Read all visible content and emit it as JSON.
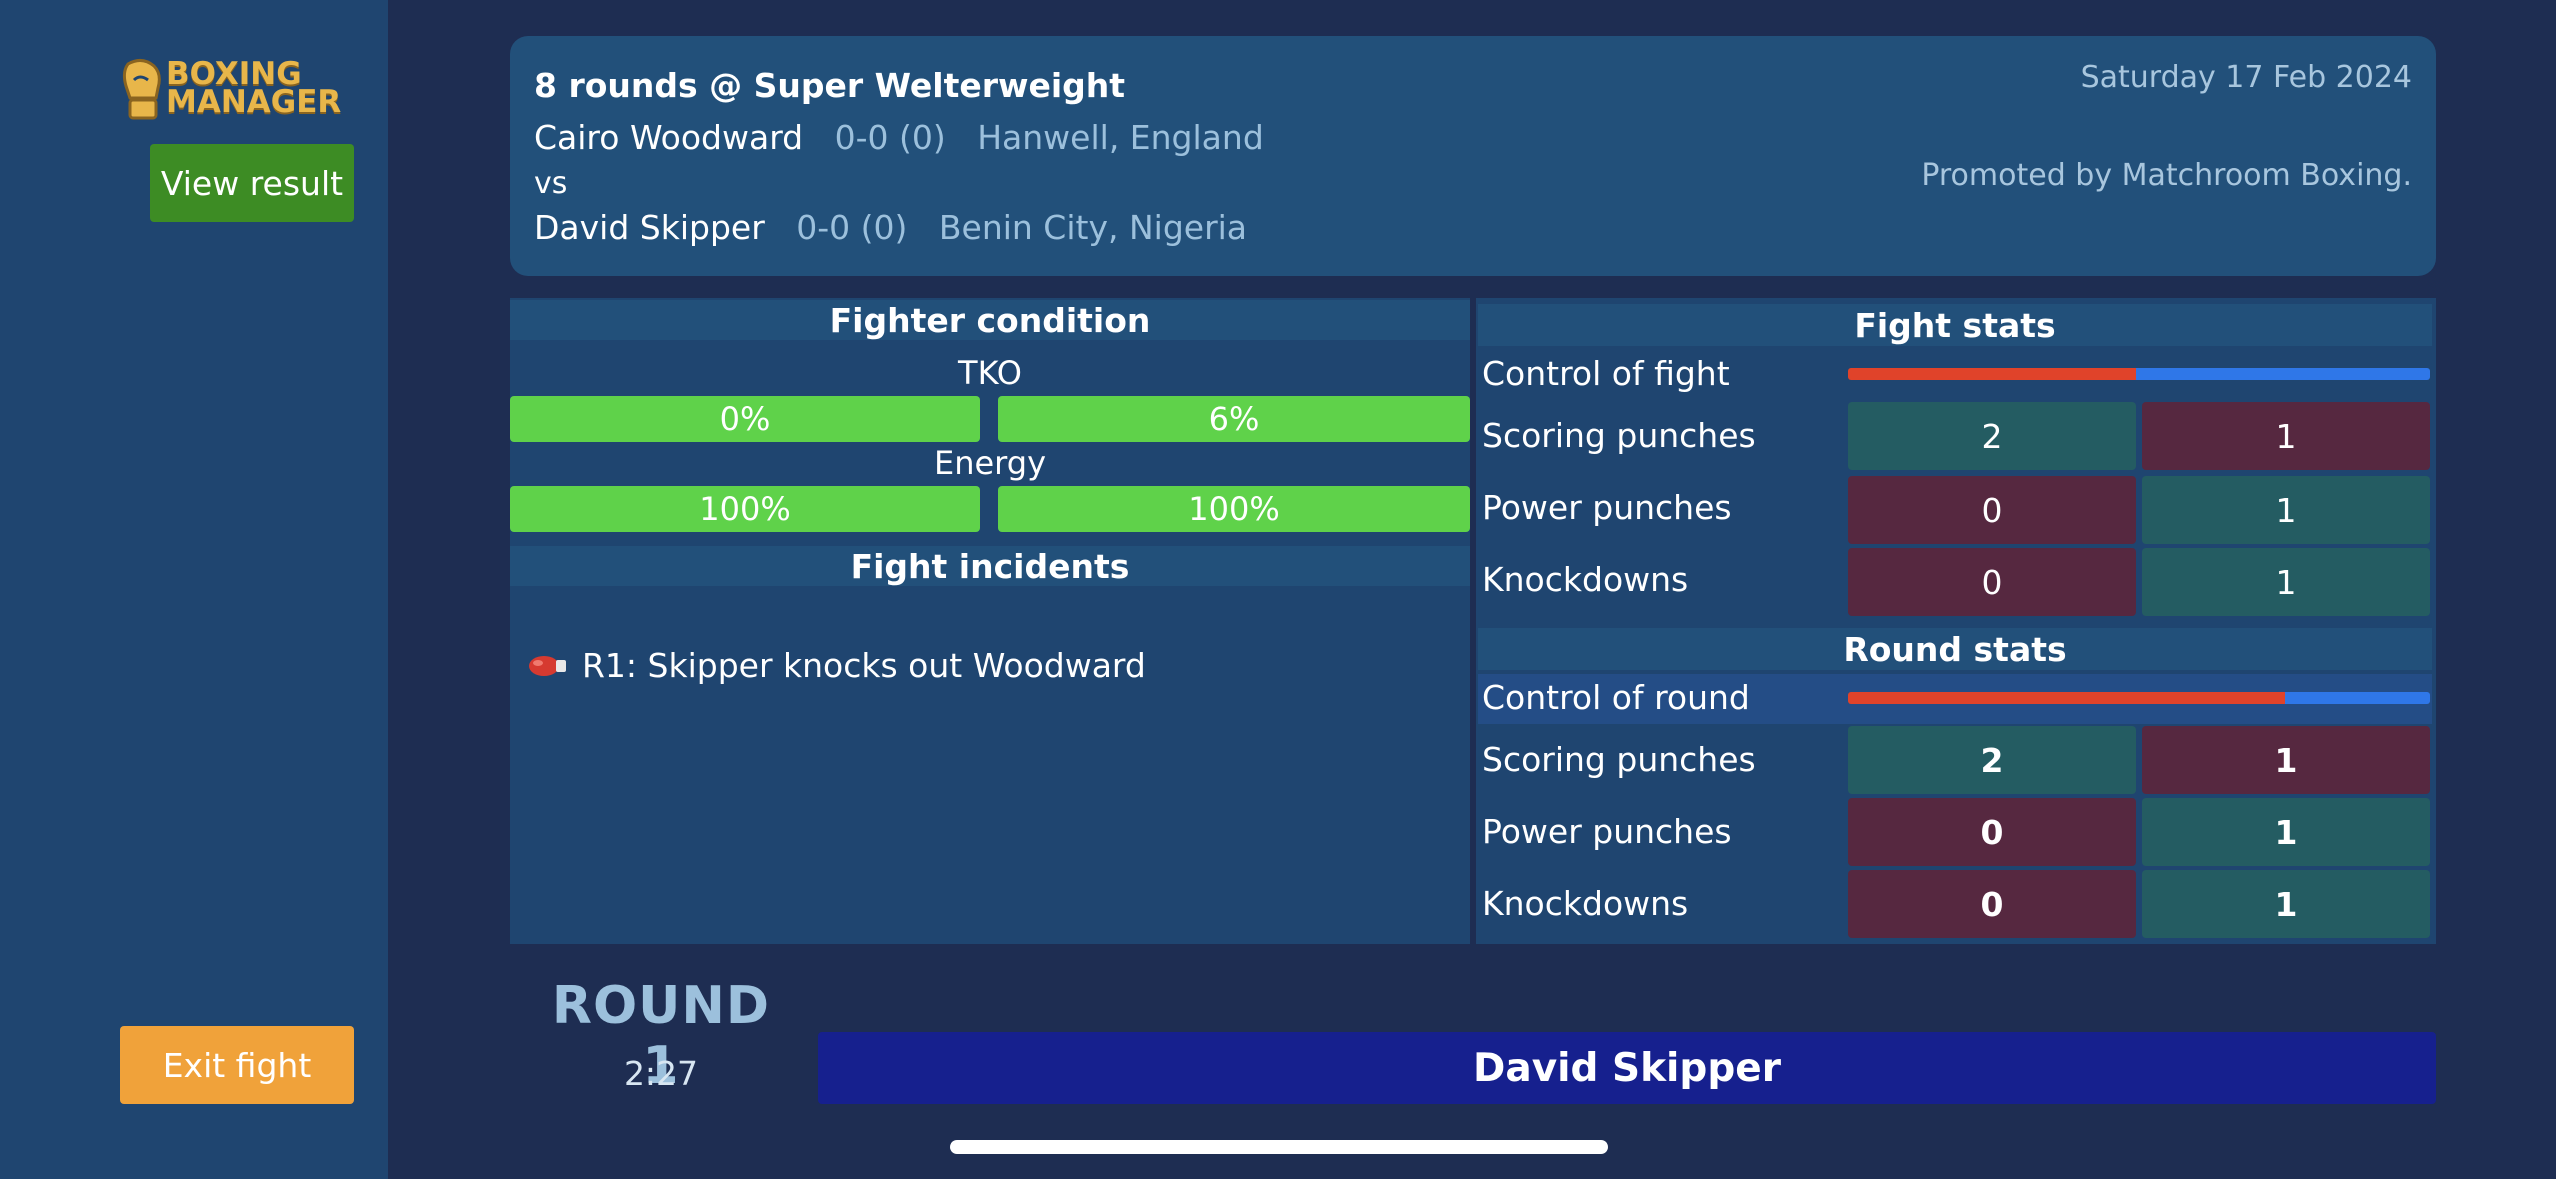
{
  "app": {
    "logo_text_line1": "BOXING",
    "logo_text_line2": "MANAGER",
    "view_result_label": "View result",
    "exit_fight_label": "Exit fight"
  },
  "header": {
    "title": "8 rounds @ Super Welterweight",
    "fighter1": {
      "name": "Cairo Woodward",
      "record": "0-0 (0)",
      "hometown": "Hanwell, England"
    },
    "vs": "vs",
    "fighter2": {
      "name": "David Skipper",
      "record": "0-0 (0)",
      "hometown": "Benin City, Nigeria"
    },
    "date": "Saturday 17 Feb 2024",
    "promoter": "Promoted by Matchroom Boxing."
  },
  "condition": {
    "title": "Fighter condition",
    "tko_label": "TKO",
    "tko": [
      "0%",
      "6%"
    ],
    "energy_label": "Energy",
    "energy": [
      "100%",
      "100%"
    ]
  },
  "incidents": {
    "title": "Fight incidents",
    "items": [
      {
        "icon": "boxing-glove-icon",
        "text": "R1: Skipper knocks out Woodward"
      }
    ]
  },
  "fight_stats": {
    "title": "Fight stats",
    "control_label": "Control of fight",
    "control_red_fraction": 0.495,
    "rows": [
      {
        "label": "Scoring punches",
        "a": "2",
        "b": "1"
      },
      {
        "label": "Power punches",
        "a": "0",
        "b": "1"
      },
      {
        "label": "Knockdowns",
        "a": "0",
        "b": "1"
      }
    ]
  },
  "round_stats": {
    "title": "Round stats",
    "control_label": "Control of round",
    "control_red_fraction": 0.75,
    "rows": [
      {
        "label": "Scoring punches",
        "a": "2",
        "b": "1"
      },
      {
        "label": "Power punches",
        "a": "0",
        "b": "1"
      },
      {
        "label": "Knockdowns",
        "a": "0",
        "b": "1"
      }
    ]
  },
  "round": {
    "label": "ROUND 1",
    "clock": "2:27"
  },
  "winner": "David Skipper",
  "colors": {
    "red": "#e0432a",
    "blue": "#2f77e8",
    "green_bar": "#5fd24a",
    "teal_cell": "#245c62",
    "maroon_cell": "#562840",
    "winner_bg": "#16208e"
  }
}
